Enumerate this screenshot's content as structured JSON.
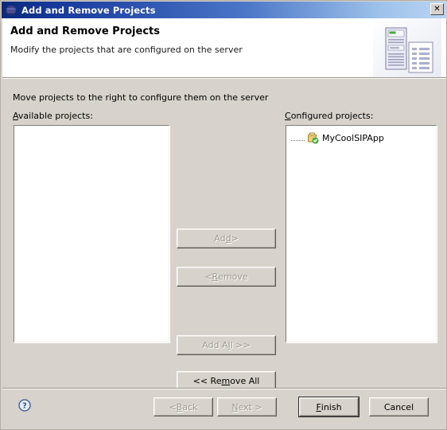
{
  "window": {
    "title": "Add and Remove Projects",
    "title_icon": "eclipse-globe-icon",
    "close_label": "✕",
    "colors": {
      "title_gradient_start": "#0a2a7a",
      "title_gradient_end": "#b9d5f2",
      "dialog_background": "#d7d2cb",
      "listbox_background": "#ffffff",
      "disabled_text": "#a09a92",
      "accent_blue": "#3a5f9e"
    }
  },
  "header": {
    "title": "Add and Remove Projects",
    "subtitle": "Modify the projects that are configured on the server",
    "art_icon": "server-and-document-icon"
  },
  "main": {
    "instruction": "Move projects to the right to configure them on the server",
    "available": {
      "label_prefix": "A",
      "label_rest": "vailable projects:",
      "label_full": "Available projects:",
      "items": []
    },
    "configured": {
      "label_prefix": "C",
      "label_rest": "onfigured projects:",
      "label_full": "Configured projects:",
      "items": [
        {
          "label": "MyCoolSIPApp",
          "icon": "project-module-icon"
        }
      ]
    },
    "transfer_buttons": [
      {
        "name": "add",
        "pre": "Ad",
        "mn": "d",
        "post": " >",
        "full": "Add >",
        "enabled": false
      },
      {
        "name": "remove",
        "pre": "< ",
        "mn": "R",
        "post": "emove",
        "full": "< Remove",
        "enabled": false
      },
      {
        "name": "add-all",
        "pre": "Add A",
        "mn": "l",
        "post": "l >>",
        "full": "Add All >>",
        "enabled": false
      },
      {
        "name": "remove-all",
        "pre": "<< Re",
        "mn": "m",
        "post": "ove All",
        "full": "<< Remove All",
        "enabled": true
      }
    ]
  },
  "footer": {
    "help_icon": "help-question-icon",
    "buttons": [
      {
        "name": "back",
        "pre": "< ",
        "mn": "B",
        "post": "ack",
        "full": "< Back",
        "enabled": false,
        "default": false
      },
      {
        "name": "next",
        "pre": "",
        "mn": "N",
        "post": "ext >",
        "full": "Next >",
        "enabled": false,
        "default": false
      },
      {
        "name": "finish",
        "pre": "",
        "mn": "F",
        "post": "inish",
        "full": "Finish",
        "enabled": true,
        "default": true
      },
      {
        "name": "cancel",
        "pre": "",
        "mn": "",
        "post": "Cancel",
        "full": "Cancel",
        "enabled": true,
        "default": false
      }
    ]
  }
}
